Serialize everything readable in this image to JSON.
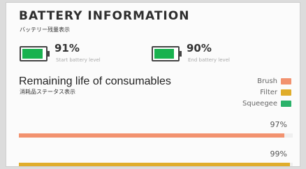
{
  "header": {
    "title": "BATTERY INFORMATION",
    "subtitle_jp": "バッテリー残量表示"
  },
  "battery": {
    "start": {
      "value_text": "91%",
      "level": 0.91,
      "caption": "Start battery level",
      "color": "#19b24f"
    },
    "end": {
      "value_text": "90%",
      "level": 0.9,
      "caption": "End battery level",
      "color": "#19b24f"
    }
  },
  "consumables": {
    "title": "Remaining life of consumables",
    "subtitle_jp": "消耗品ステータス表示",
    "legend": [
      {
        "label": "Brush",
        "color": "#f2926f"
      },
      {
        "label": "Filter",
        "color": "#e0ad2b"
      },
      {
        "label": "Squeegee",
        "color": "#2bb26a"
      }
    ],
    "bars": {
      "brush": {
        "value_text": "97%",
        "level": 0.97,
        "color": "#f2926f"
      },
      "filter": {
        "value_text": "99%",
        "level": 0.99,
        "color": "#e0ad2b"
      }
    }
  }
}
